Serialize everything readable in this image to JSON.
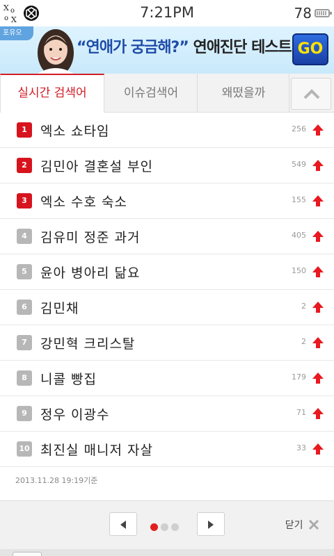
{
  "status_bar": {
    "logo_text": "XO XO",
    "time": "7:21PM",
    "battery": "78"
  },
  "banner": {
    "corner_label": "포유오",
    "headline_quote": "“연애가 궁금해?”",
    "headline_emph": "연애진단 테스트",
    "go_label": "GO"
  },
  "tabs": [
    {
      "label": "실시간 검색어",
      "active": true
    },
    {
      "label": "이슈검색어",
      "active": false
    },
    {
      "label": "왜떴을까",
      "active": false
    }
  ],
  "keywords": [
    {
      "rank": "1",
      "keyword": "엑소 쇼타임",
      "count": "256",
      "highlight": true
    },
    {
      "rank": "2",
      "keyword": "김민아 결혼설 부인",
      "count": "549",
      "highlight": true
    },
    {
      "rank": "3",
      "keyword": "엑소 수호 숙소",
      "count": "155",
      "highlight": true
    },
    {
      "rank": "4",
      "keyword": "김유미 정준 과거",
      "count": "405",
      "highlight": false
    },
    {
      "rank": "5",
      "keyword": "윤아 병아리 닮요",
      "count": "150",
      "highlight": false
    },
    {
      "rank": "6",
      "keyword": "김민채",
      "count": "2",
      "highlight": false
    },
    {
      "rank": "7",
      "keyword": "강민혁 크리스탈",
      "count": "2",
      "highlight": false
    },
    {
      "rank": "8",
      "keyword": "니콜 빵집",
      "count": "179",
      "highlight": false
    },
    {
      "rank": "9",
      "keyword": "정우 이광수",
      "count": "71",
      "highlight": false
    },
    {
      "rank": "10",
      "keyword": "최진실 매니저 자살",
      "count": "33",
      "highlight": false
    }
  ],
  "timestamp": "2013.11.28 19:19기준",
  "pagination": {
    "page_count": 3,
    "current": 1
  },
  "close_label": "닫기",
  "colors": {
    "accent": "#d7141e",
    "rank_gray": "#b7b7b7",
    "arrow": "#e8191f",
    "banner_blue": "#1e4ca8",
    "go_yellow": "#ffe200"
  }
}
